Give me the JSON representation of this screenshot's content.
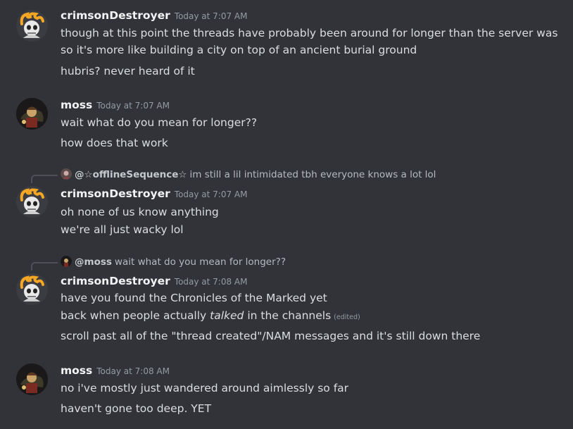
{
  "messages": [
    {
      "author": "crimsonDestroyer",
      "timestamp": "Today at 7:07 AM",
      "lines": [
        "though at this point the threads have probably been around for longer than the server was",
        "so it's more like building a city on top of an ancient burial ground",
        "hubris? never heard of it"
      ]
    },
    {
      "author": "moss",
      "timestamp": "Today at 7:07 AM",
      "lines": [
        "wait what do you mean for longer??",
        "how does that work"
      ]
    },
    {
      "reply": {
        "name": "@☆offlineSequence☆",
        "text": "im still a lil intimidated tbh everyone knows a lot lol"
      },
      "author": "crimsonDestroyer",
      "timestamp": "Today at 7:07 AM",
      "lines": [
        "oh none of us know anything",
        "we're all just wacky lol"
      ]
    },
    {
      "reply": {
        "name": "@moss",
        "text": "wait what do you mean for longer??"
      },
      "author": "crimsonDestroyer",
      "timestamp": "Today at 7:08 AM",
      "lines": [
        "have you found the Chronicles of the Marked yet",
        {
          "pre": "back when people actually ",
          "em": "talked",
          "post": " in the channels",
          "edited": "(edited)"
        },
        "scroll past all of the \"thread created\"/NAM messages and it's still down there"
      ]
    },
    {
      "author": "moss",
      "timestamp": "Today at 7:08 AM",
      "lines": [
        "no i've mostly just wandered around aimlessly so far",
        "haven't gone too deep. YET"
      ]
    }
  ],
  "icons": {
    "crimson_avatar": "crimson-destroyer-avatar",
    "moss_avatar": "moss-avatar",
    "offline_avatar": "offline-sequence-avatar"
  },
  "colors": {
    "background": "#313338",
    "author": "#f2f3f5",
    "text": "#dbdee1",
    "muted": "#949ba4",
    "accent_orange": "#f5a623"
  }
}
